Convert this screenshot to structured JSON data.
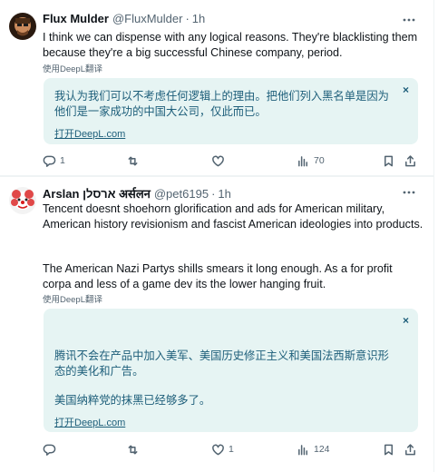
{
  "tweets": [
    {
      "author": "Flux Mulder",
      "handle": "@FluxMulder",
      "separator": "·",
      "time": "1h",
      "text": "I think we can dispense with any logical reasons. They're blacklisting them because they're a big successful Chinese company, period.",
      "translated_by": "使用DeepL翻译",
      "translation": "我认为我们可以不考虑任何逻辑上的理由。把他们列入黑名单是因为他们是一家成功的中国大公司，仅此而已。",
      "translation_link": "打开DeepL.com",
      "close": "×",
      "replies": "1",
      "retweets": "",
      "likes": "",
      "views": "70"
    },
    {
      "author": "Arslan ארסלן अर्सलन",
      "handle": "@pet6195",
      "separator": "·",
      "time": "1h",
      "text_p1": "Tencent doesnt shoehorn glorification and ads for American military, American history revisionism and fascist American ideologies into products.",
      "text_p2": "The American Nazi Partys shills smears it long enough. As a for profit corpa and less of a game dev its the lower hanging fruit.",
      "translated_by": "使用DeepL翻译",
      "translation_p1": "腾讯不会在产品中加入美军、美国历史修正主义和美国法西斯意识形态的美化和广告。",
      "translation_p2": "美国纳粹党的抹黑已经够多了。",
      "translation_link": "打开DeepL.com",
      "close": "×",
      "replies": "",
      "retweets": "",
      "likes": "1",
      "views": "124"
    }
  ],
  "colors": {
    "text": "#0f1419",
    "muted": "#536471",
    "card_bg": "#e6f4f3",
    "card_text": "#1d5e7a",
    "divider": "#eff3f4"
  },
  "icons": [
    "more-icon",
    "reply-icon",
    "retweet-icon",
    "like-icon",
    "views-icon",
    "bookmark-icon",
    "share-icon"
  ]
}
